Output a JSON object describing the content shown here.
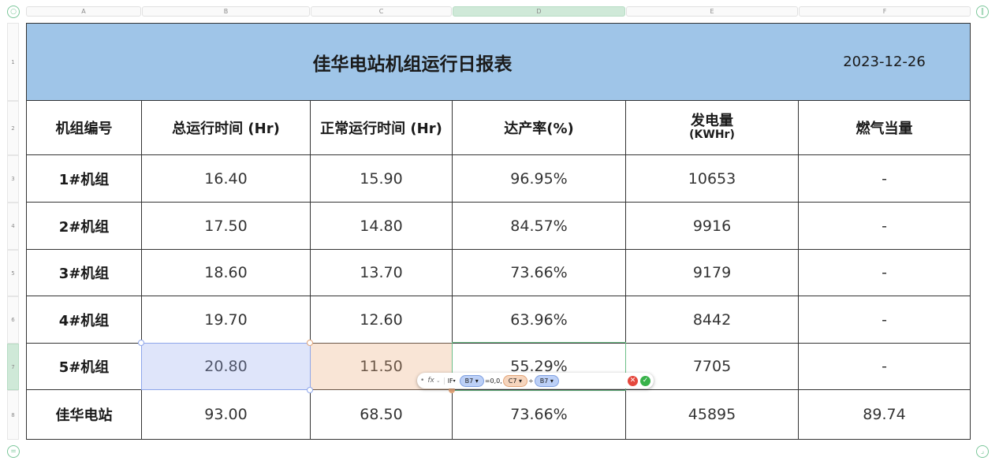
{
  "columns": [
    "A",
    "B",
    "C",
    "D",
    "E",
    "F"
  ],
  "rows": [
    "1",
    "2",
    "3",
    "4",
    "5",
    "6",
    "7",
    "8"
  ],
  "title": "佳华电站机组运行日报表",
  "date": "2023-12-26",
  "headers": [
    "机组编号",
    "总运行时间 (Hr)",
    "正常运行时间 (Hr)",
    "达产率(%)",
    "发电量",
    "燃气当量"
  ],
  "header_unit_e": "(KWHr)",
  "data_rows": [
    [
      "1#机组",
      "16.40",
      "15.90",
      "96.95%",
      "10653",
      "-"
    ],
    [
      "2#机组",
      "17.50",
      "14.80",
      "84.57%",
      "9916",
      "-"
    ],
    [
      "3#机组",
      "18.60",
      "13.70",
      "73.66%",
      "9179",
      "-"
    ],
    [
      "4#机组",
      "19.70",
      "12.60",
      "63.96%",
      "8442",
      "-"
    ],
    [
      "5#机组",
      "20.80",
      "11.50",
      "55.29%",
      "7705",
      "-"
    ],
    [
      "佳华电站",
      "93.00",
      "68.50",
      "73.66%",
      "45895",
      "89.74"
    ]
  ],
  "formula": {
    "fx": "fx",
    "func": "IF",
    "ref1": "B7",
    "mid": "=0,0,",
    "ref2": "C7",
    "op": "÷",
    "ref3": "B7"
  },
  "colors": {
    "title_bg": "#9fc5e8",
    "selected_header": "#cfe9d8",
    "b7_fill": "#dfe5fb",
    "c7_fill": "#f7e3d6"
  }
}
